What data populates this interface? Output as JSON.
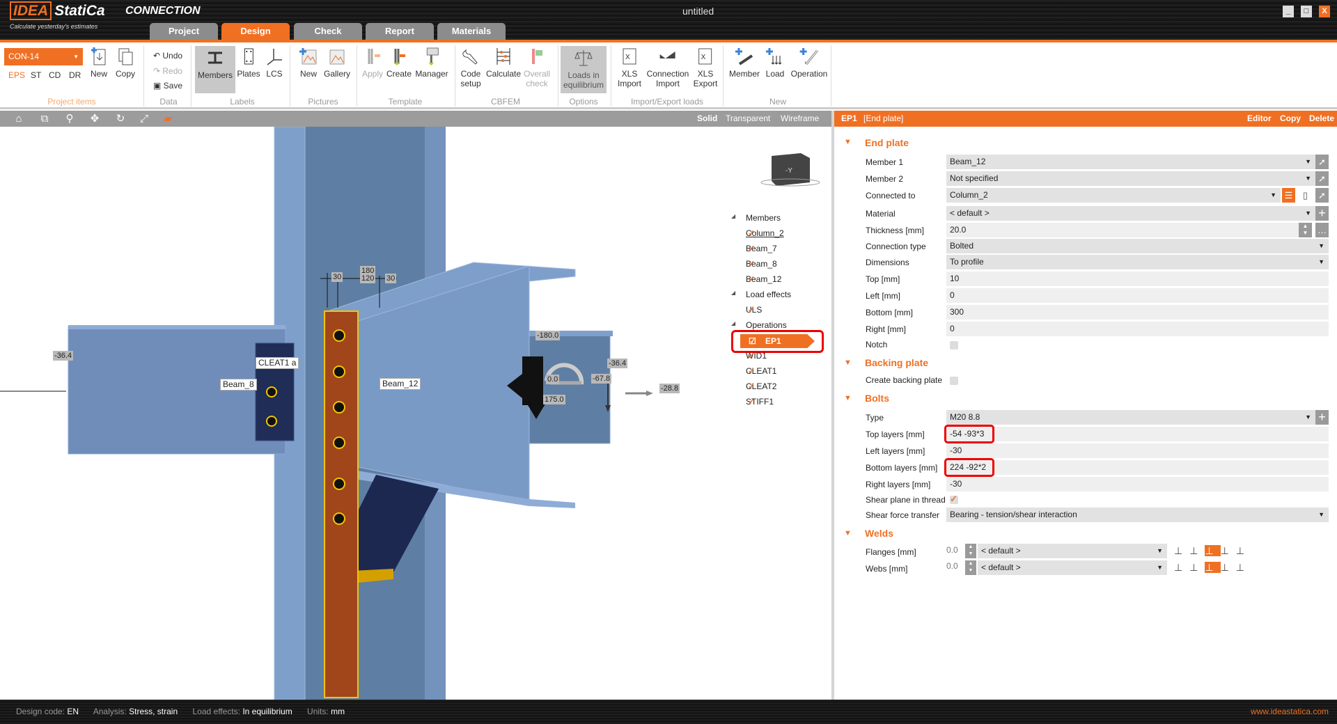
{
  "app": {
    "brand": "IDEA",
    "brand2": "StatiCa",
    "product": "CONNECTION",
    "tagline": "Calculate yesterday's estimates",
    "doc_title": "untitled",
    "win": [
      "_",
      "□",
      "X"
    ]
  },
  "tabs": [
    "Project",
    "Design",
    "Check",
    "Report",
    "Materials"
  ],
  "ribbon": {
    "project_item": "CON-14",
    "modes": [
      "EPS",
      "ST",
      "CD",
      "DR"
    ],
    "new": "New",
    "copy": "Copy",
    "undo": "Undo",
    "redo": "Redo",
    "save": "Save",
    "members": "Members",
    "plates": "Plates",
    "lcs": "LCS",
    "pic_new": "New",
    "gallery": "Gallery",
    "apply": "Apply",
    "create": "Create",
    "manager": "Manager",
    "code_setup": [
      "Code",
      "setup"
    ],
    "calculate": "Calculate",
    "overall_check": [
      "Overall",
      "check"
    ],
    "loads_eq": [
      "Loads in",
      "equilibrium"
    ],
    "xls_import": [
      "XLS",
      "Import"
    ],
    "conn_import": [
      "Connection",
      "Import"
    ],
    "xls_export": [
      "XLS",
      "Export"
    ],
    "member": "Member",
    "load": "Load",
    "operation": "Operation",
    "groups": [
      "Project items",
      "Data",
      "Labels",
      "Pictures",
      "Template",
      "CBFEM",
      "Options",
      "Import/Export loads",
      "New"
    ]
  },
  "view": {
    "modes": [
      "Solid",
      "Transparent",
      "Wireframe"
    ],
    "labels": {
      "beam8": "Beam_8",
      "beam12": "Beam_12",
      "cleat": "CLEAT1 a",
      "cube": "-Y"
    },
    "dims": [
      "180",
      "120",
      "30",
      "30"
    ],
    "loads": [
      "-36.4",
      "-180.0",
      "-36.4",
      "-67.8",
      "0.0",
      "175.0",
      "-28.8"
    ]
  },
  "tree": {
    "members_h": "Members",
    "members": [
      "Column_2",
      "Beam_7",
      "Beam_8",
      "Beam_12"
    ],
    "loads_h": "Load effects",
    "loads": [
      "ULS"
    ],
    "ops_h": "Operations",
    "ops": [
      "EP1",
      "WID1",
      "CLEAT1",
      "CLEAT2",
      "STIFF1"
    ]
  },
  "panel": {
    "header": {
      "name": "EP1",
      "type": "[End plate]",
      "editor": "Editor",
      "copy": "Copy",
      "delete": "Delete"
    },
    "end_plate": {
      "title": "End plate",
      "rows": [
        {
          "label": "Member 1",
          "value": "Beam_12"
        },
        {
          "label": "Member 2",
          "value": "Not specified"
        },
        {
          "label": "Connected to",
          "value": "Column_2"
        },
        {
          "label": "Material",
          "value": "< default >"
        },
        {
          "label": "Thickness [mm]",
          "value": "20.0"
        },
        {
          "label": "Connection type",
          "value": "Bolted"
        },
        {
          "label": "Dimensions",
          "value": "To profile"
        },
        {
          "label": "Top [mm]",
          "value": "10"
        },
        {
          "label": "Left [mm]",
          "value": "0"
        },
        {
          "label": "Bottom [mm]",
          "value": "300"
        },
        {
          "label": "Right [mm]",
          "value": "0"
        },
        {
          "label": "Notch",
          "value": ""
        }
      ]
    },
    "backing": {
      "title": "Backing plate",
      "label": "Create backing plate"
    },
    "bolts": {
      "title": "Bolts",
      "rows": [
        {
          "label": "Type",
          "value": "M20 8.8"
        },
        {
          "label": "Top layers [mm]",
          "value": "-54 -93*3"
        },
        {
          "label": "Left layers [mm]",
          "value": "-30"
        },
        {
          "label": "Bottom layers [mm]",
          "value": "224 -92*2"
        },
        {
          "label": "Right layers [mm]",
          "value": "-30"
        },
        {
          "label": "Shear plane in thread",
          "value": "✓"
        },
        {
          "label": "Shear force transfer",
          "value": "Bearing - tension/shear interaction"
        }
      ]
    },
    "welds": {
      "title": "Welds",
      "rows": [
        {
          "label": "Flanges [mm]",
          "size": "0.0",
          "type": "< default >"
        },
        {
          "label": "Webs [mm]",
          "size": "0.0",
          "type": "< default >"
        }
      ]
    }
  },
  "status": {
    "code_l": "Design code:",
    "code": "EN",
    "an_l": "Analysis:",
    "an": "Stress, strain",
    "le_l": "Load effects:",
    "le": "In equilibrium",
    "u_l": "Units:",
    "u": "mm",
    "url": "www.ideastatica.com"
  },
  "colors": {
    "accent": "#f07023",
    "steel": "#7a9ac6",
    "plate": "#a0461a"
  }
}
